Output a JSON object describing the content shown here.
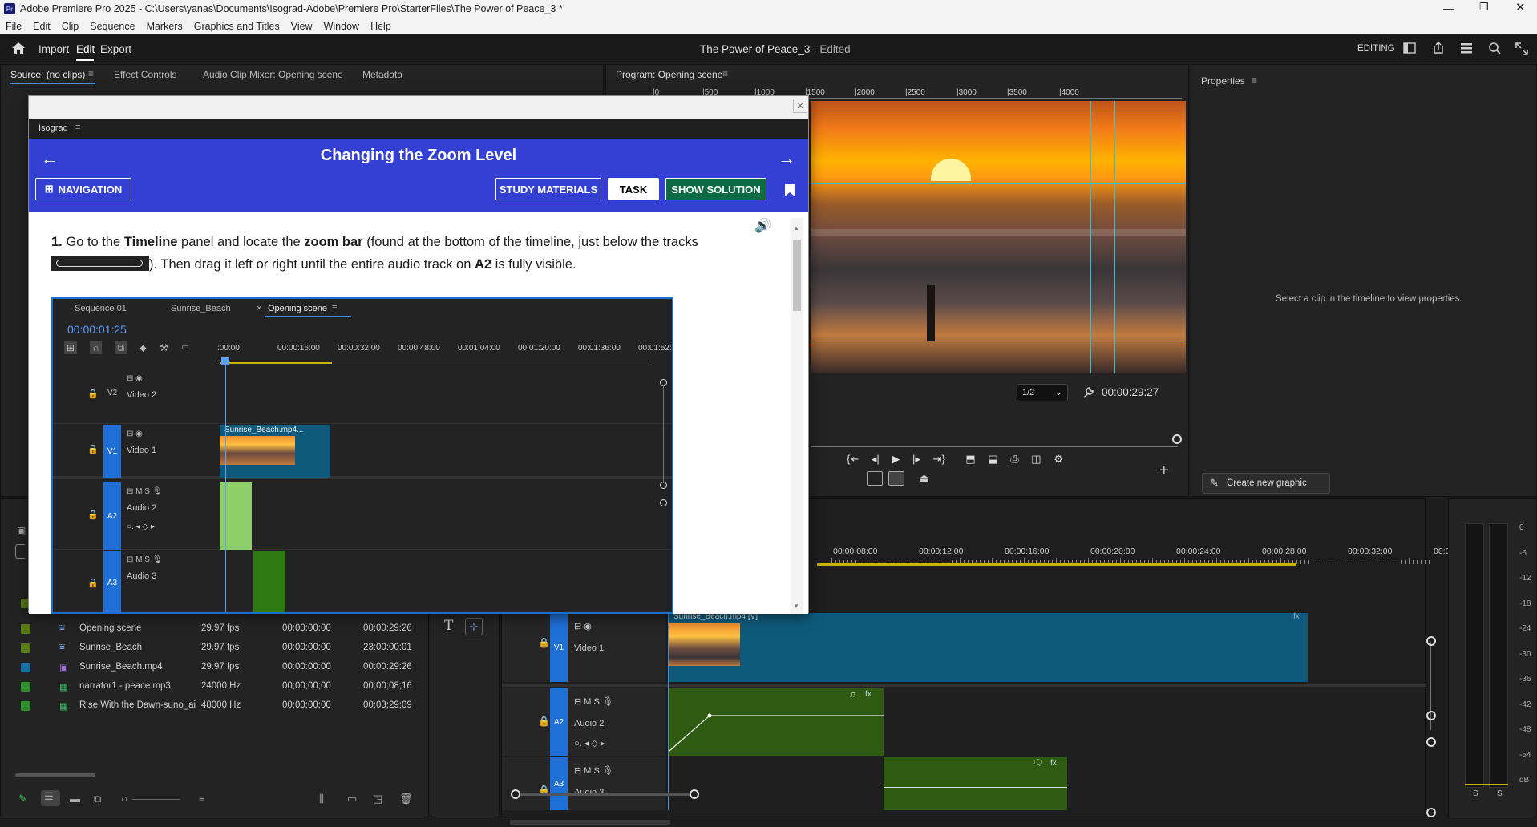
{
  "window": {
    "app_icon": "Pr",
    "title": "Adobe Premiere Pro 2025 - C:\\Users\\yanas\\Documents\\Isograd-Adobe\\Premiere Pro\\StarterFiles\\The Power of Peace_3 *"
  },
  "menu": [
    "File",
    "Edit",
    "Clip",
    "Sequence",
    "Markers",
    "Graphics and Titles",
    "View",
    "Window",
    "Help"
  ],
  "workspace": {
    "import": "Import",
    "edit": "Edit",
    "export": "Export",
    "project_title": "The Power of Peace_3",
    "project_state": "- Edited",
    "editing_label": "EDITING"
  },
  "source_panel": {
    "tabs": [
      "Source: (no clips)",
      "Effect Controls",
      "Audio Clip Mixer: Opening scene",
      "Metadata"
    ]
  },
  "program_panel": {
    "tab": "Program: Opening scene",
    "ruler_labels": [
      "0",
      "500",
      "1000",
      "1500",
      "2000",
      "2500",
      "3000",
      "3500",
      "4000"
    ],
    "resolution": "1/2",
    "timecode": "00:00:29:27"
  },
  "properties_panel": {
    "tab": "Properties",
    "empty_message": "Select a clip in the timeline to view properties.",
    "create_graphic": "Create new graphic"
  },
  "project_list": {
    "rows": [
      {
        "name": "Opening scene",
        "rate": "29.97 fps",
        "start": "00:00:00:00",
        "end": "00:00:29:26",
        "color": "#5a7a1a",
        "icon": "sequence-icon"
      },
      {
        "name": "Sunrise_Beach",
        "rate": "29.97 fps",
        "start": "00:00:00:00",
        "end": "23:00:00:01",
        "color": "#5a7a1a",
        "icon": "sequence-icon"
      },
      {
        "name": "Sunrise_Beach.mp4",
        "rate": "29.97 fps",
        "start": "00:00:00:00",
        "end": "00:00:29:26",
        "color": "#1b6fa0",
        "icon": "video-file-icon"
      },
      {
        "name": "narrator1 - peace.mp3",
        "rate": "24000 Hz",
        "start": "00;00;00;00",
        "end": "00;00;08;16",
        "color": "#2f8f2f",
        "icon": "audio-file-icon"
      },
      {
        "name": "Rise With the Dawn-suno_ai",
        "rate": "48000 Hz",
        "start": "00;00;00;00",
        "end": "00;03;29;09",
        "color": "#2f8f2f",
        "icon": "audio-file-icon"
      }
    ]
  },
  "timeline": {
    "ruler_labels": [
      "00:00:08:00",
      "00:00:12:00",
      "00:00:16:00",
      "00:00:20:00",
      "00:00:24:00",
      "00:00:28:00",
      "00:00:32:00",
      "00:0"
    ],
    "tracks": [
      {
        "id": "V1",
        "name": "Video 1",
        "ctrls": "⊟ ◉"
      },
      {
        "id": "A2",
        "name": "Audio 2",
        "ctrls": "⊟ M S 🎙"
      },
      {
        "id": "A3",
        "name": "Audio 3",
        "ctrls": "⊟ M S 🎙"
      }
    ],
    "video_clip_label": "Sunrise_Beach.mp4 [V]",
    "fx": "fx"
  },
  "meter": {
    "labels": [
      "0",
      "-6",
      "-12",
      "-18",
      "-24",
      "-30",
      "-36",
      "-42",
      "-48",
      "-54",
      "dB"
    ],
    "solo": [
      "S",
      "S"
    ]
  },
  "overlay": {
    "panel_name": "Isograd",
    "header_title": "Changing the Zoom Level",
    "nav_button": "NAVIGATION",
    "study_button": "STUDY MATERIALS",
    "task_button": "TASK",
    "solution_button": "SHOW SOLUTION",
    "step_number": "1.",
    "instruction_part1": "Go to the ",
    "instruction_bold1": "Timeline",
    "instruction_part2": " panel and locate the ",
    "instruction_bold2": "zoom bar",
    "instruction_part3": " (found at the bottom of the timeline, just below the tracks",
    "instruction_part4": "). Then drag it left or right until the entire audio track on ",
    "instruction_bold3": "A2",
    "instruction_part5": " is fully visible.",
    "shot": {
      "tabs": [
        "Sequence 01",
        "Sunrise_Beach",
        "Opening scene"
      ],
      "close": "×",
      "timecode": "00:00:01:25",
      "ruler": [
        ":00:00",
        "00:00:16:00",
        "00:00:32:00",
        "00:00:48:00",
        "00:01:04:00",
        "00:01:20:00",
        "00:01:36:00",
        "00:01:52:"
      ],
      "tracks": [
        {
          "id": "V2",
          "name": "Video 2"
        },
        {
          "id": "V1",
          "name": "Video 1"
        },
        {
          "id": "A2",
          "name": "Audio 2"
        },
        {
          "id": "A3",
          "name": "Audio 3"
        }
      ],
      "clip_label": "Sunrise_Beach.mp4..."
    }
  }
}
